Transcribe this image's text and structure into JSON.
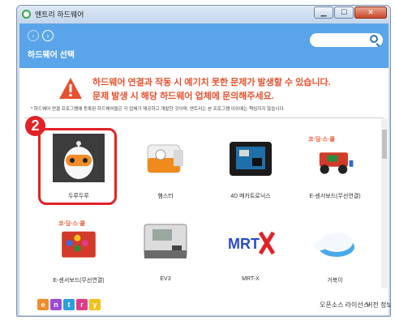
{
  "window": {
    "title": "엔트리 하드웨어",
    "btn_min": "▁",
    "btn_max": "☐",
    "btn_close": "✕"
  },
  "header": {
    "title": "하드웨어 선택",
    "back_icon": "arrow-left-icon",
    "forward_icon": "arrow-right-icon"
  },
  "search": {
    "placeholder": "",
    "icon": "search-icon"
  },
  "warning": {
    "line1": "하드웨어 연결과 작동 시 예기치 못한 문제가 발생할 수 있습니다.",
    "line2": "문제 발생 시 해당 하드웨어 업체에 문의해주세요.",
    "disclaimer": "* 하드웨어 연결 프로그램에 등록된 하드웨어들은 각 업체가 제공하고 개발한 것이며, 엔트리는 본 프로그램 이외에는 책임지지 않습니다."
  },
  "hardware": [
    {
      "label": "두루두루",
      "icon": "durudur-robot-icon"
    },
    {
      "label": "햄스터",
      "icon": "hamster-robot-icon"
    },
    {
      "label": "4D 메카트로닉스",
      "icon": "4d-board-icon"
    },
    {
      "label": "E-센서보드(무선연결)",
      "icon": "e-sensor-car-icon"
    },
    {
      "label": "E-센서보드(무선연결)",
      "icon": "e-sensor-board-icon"
    },
    {
      "label": "EV3",
      "icon": "ev3-brick-icon"
    },
    {
      "label": "MRT-X",
      "icon": "mrt-x-logo-icon"
    },
    {
      "label": "거북이",
      "icon": "turtle-robot-icon"
    }
  ],
  "badge_text": "코·딩·스·쿨",
  "footer": {
    "logo_letters": [
      "e",
      "n",
      "t",
      "r",
      "y"
    ],
    "oss_label": "오픈소스 라이선스",
    "version_label": "버전 정보"
  },
  "annotation": {
    "number": "2"
  },
  "colors": {
    "header": "#5aa5ea",
    "warning": "#e8512e",
    "callout": "#e32227"
  }
}
